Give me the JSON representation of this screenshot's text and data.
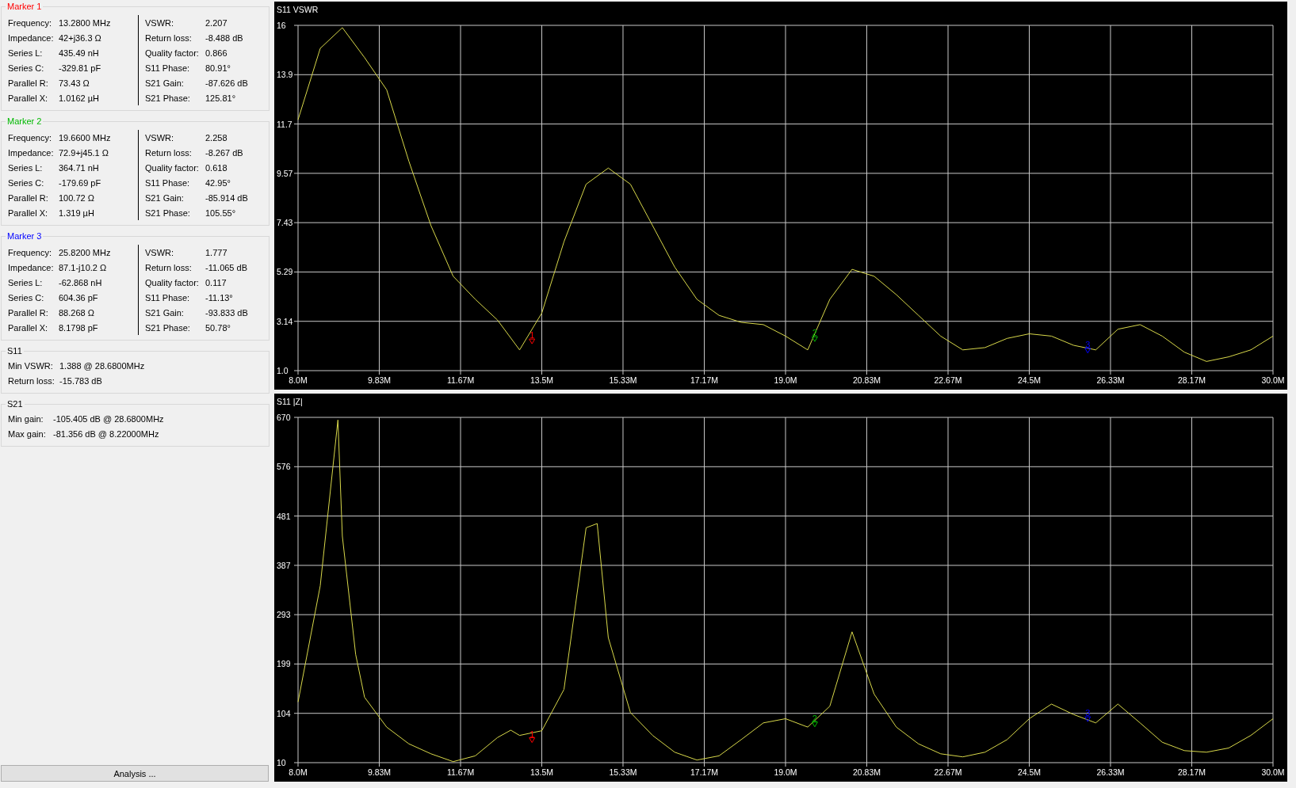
{
  "markers": [
    {
      "title": "Marker 1",
      "color": "#ff0000",
      "left": [
        {
          "label": "Frequency:",
          "value": "13.2800 MHz"
        },
        {
          "label": "Impedance:",
          "value": "42+j36.3 Ω"
        },
        {
          "label": "Series L:",
          "value": "435.49 nH"
        },
        {
          "label": "Series C:",
          "value": "-329.81 pF"
        },
        {
          "label": "Parallel R:",
          "value": "73.43 Ω"
        },
        {
          "label": "Parallel X:",
          "value": "1.0162 µH"
        }
      ],
      "right": [
        {
          "label": "VSWR:",
          "value": "2.207"
        },
        {
          "label": "Return loss:",
          "value": "-8.488 dB"
        },
        {
          "label": "Quality factor:",
          "value": "0.866"
        },
        {
          "label": "S11 Phase:",
          "value": "80.91°"
        },
        {
          "label": "S21 Gain:",
          "value": "-87.626 dB"
        },
        {
          "label": "S21 Phase:",
          "value": "125.81°"
        }
      ]
    },
    {
      "title": "Marker 2",
      "color": "#00b800",
      "left": [
        {
          "label": "Frequency:",
          "value": "19.6600 MHz"
        },
        {
          "label": "Impedance:",
          "value": "72.9+j45.1 Ω"
        },
        {
          "label": "Series L:",
          "value": "364.71 nH"
        },
        {
          "label": "Series C:",
          "value": "-179.69 pF"
        },
        {
          "label": "Parallel R:",
          "value": "100.72 Ω"
        },
        {
          "label": "Parallel X:",
          "value": "1.319 µH"
        }
      ],
      "right": [
        {
          "label": "VSWR:",
          "value": "2.258"
        },
        {
          "label": "Return loss:",
          "value": "-8.267 dB"
        },
        {
          "label": "Quality factor:",
          "value": "0.618"
        },
        {
          "label": "S11 Phase:",
          "value": "42.95°"
        },
        {
          "label": "S21 Gain:",
          "value": "-85.914 dB"
        },
        {
          "label": "S21 Phase:",
          "value": "105.55°"
        }
      ]
    },
    {
      "title": "Marker 3",
      "color": "#0000ff",
      "left": [
        {
          "label": "Frequency:",
          "value": "25.8200 MHz"
        },
        {
          "label": "Impedance:",
          "value": "87.1-j10.2 Ω"
        },
        {
          "label": "Series L:",
          "value": "-62.868 nH"
        },
        {
          "label": "Series C:",
          "value": "604.36 pF"
        },
        {
          "label": "Parallel R:",
          "value": "88.268 Ω"
        },
        {
          "label": "Parallel X:",
          "value": "8.1798 pF"
        }
      ],
      "right": [
        {
          "label": "VSWR:",
          "value": "1.777"
        },
        {
          "label": "Return loss:",
          "value": "-11.065 dB"
        },
        {
          "label": "Quality factor:",
          "value": "0.117"
        },
        {
          "label": "S11 Phase:",
          "value": "-11.13°"
        },
        {
          "label": "S21 Gain:",
          "value": "-93.833 dB"
        },
        {
          "label": "S21 Phase:",
          "value": "50.78°"
        }
      ]
    }
  ],
  "summaries": [
    {
      "title": "S11",
      "rows": [
        {
          "label": "Min VSWR:",
          "value": "1.388 @ 28.6800MHz"
        },
        {
          "label": "Return loss:",
          "value": "-15.783 dB"
        }
      ]
    },
    {
      "title": "S21",
      "rows": [
        {
          "label": "Min gain:",
          "value": "-105.405 dB @ 28.6800MHz"
        },
        {
          "label": "Max gain:",
          "value": "-81.356 dB @ 8.22000MHz"
        }
      ]
    }
  ],
  "analysis_button": "Analysis ...",
  "charts": [
    {
      "chart_data": {
        "type": "line",
        "title": "S11 VSWR",
        "grid": true,
        "x": [
          8,
          8.5,
          9,
          9.5,
          10,
          10.5,
          11,
          11.5,
          12,
          12.5,
          13,
          13.5,
          14,
          14.5,
          15,
          15.5,
          16,
          16.5,
          17,
          17.5,
          18,
          18.5,
          19,
          19.5,
          20,
          20.5,
          21,
          21.5,
          22,
          22.5,
          23,
          23.5,
          24,
          24.5,
          25,
          25.5,
          26,
          26.5,
          27,
          27.5,
          28,
          28.5,
          29,
          29.5,
          30
        ],
        "series": [
          {
            "color": "#d8d84a",
            "values": [
              11.9,
              15.0,
              15.9,
              14.6,
              13.2,
              10.1,
              7.3,
              5.1,
              4.1,
              3.2,
              1.9,
              3.5,
              6.6,
              9.1,
              9.8,
              9.1,
              7.3,
              5.5,
              4.1,
              3.4,
              3.1,
              3.0,
              2.5,
              1.9,
              4.1,
              5.4,
              5.1,
              4.3,
              3.4,
              2.5,
              1.9,
              2.0,
              2.4,
              2.6,
              2.5,
              2.1,
              1.9,
              2.8,
              3.0,
              2.5,
              1.8,
              1.4,
              1.6,
              1.9,
              2.5
            ]
          }
        ],
        "xlim": [
          8,
          30
        ],
        "ylim": [
          1,
          16
        ],
        "xticks": [
          {
            "value": 8,
            "label": "8.0M"
          },
          {
            "value": 9.833,
            "label": "9.83M"
          },
          {
            "value": 11.667,
            "label": "11.67M"
          },
          {
            "value": 13.5,
            "label": "13.5M"
          },
          {
            "value": 15.333,
            "label": "15.33M"
          },
          {
            "value": 17.167,
            "label": "17.17M"
          },
          {
            "value": 19,
            "label": "19.0M"
          },
          {
            "value": 20.833,
            "label": "20.83M"
          },
          {
            "value": 22.667,
            "label": "22.67M"
          },
          {
            "value": 24.5,
            "label": "24.5M"
          },
          {
            "value": 26.333,
            "label": "26.33M"
          },
          {
            "value": 28.167,
            "label": "28.17M"
          },
          {
            "value": 30,
            "label": "30.0M"
          }
        ],
        "yticks": [
          {
            "value": 1,
            "label": "1.0"
          },
          {
            "value": 3.143,
            "label": "3.14"
          },
          {
            "value": 5.286,
            "label": "5.29"
          },
          {
            "value": 7.429,
            "label": "7.43"
          },
          {
            "value": 9.571,
            "label": "9.57"
          },
          {
            "value": 11.714,
            "label": "11.7"
          },
          {
            "value": 13.857,
            "label": "13.9"
          },
          {
            "value": 16,
            "label": "16"
          }
        ],
        "annotations": [
          {
            "x": 13.28,
            "y": 2.2,
            "text": "1"
          },
          {
            "x": 19.66,
            "y": 2.3,
            "text": "2"
          },
          {
            "x": 25.82,
            "y": 1.8,
            "text": "3"
          }
        ]
      }
    },
    {
      "chart_data": {
        "type": "line",
        "title": "S11 |Z|",
        "grid": true,
        "x": [
          8,
          8.5,
          8.9,
          9,
          9.3,
          9.5,
          10,
          10.5,
          11,
          11.5,
          12,
          12.5,
          12.8,
          13,
          13.5,
          14,
          14.5,
          14.75,
          15,
          15.5,
          16,
          16.5,
          17,
          17.5,
          18,
          18.5,
          19,
          19.5,
          20,
          20.5,
          21,
          21.5,
          22,
          22.5,
          23,
          23.5,
          24,
          24.5,
          25,
          25.5,
          26,
          26.5,
          27,
          27.5,
          28,
          28.5,
          29,
          29.5,
          30
        ],
        "series": [
          {
            "color": "#d8d84a",
            "values": [
              126,
              348,
              665,
              443,
              217,
              135,
              78,
              46,
              27,
              12,
              23,
              58,
              72,
              62,
              71,
              150,
              459,
              467,
              249,
              106,
              62,
              30,
              15,
              23,
              54,
              86,
              94,
              78,
              118,
              260,
              141,
              78,
              46,
              27,
              21,
              30,
              54,
              94,
              122,
              102,
              86,
              122,
              86,
              49,
              33,
              30,
              38,
              62,
              94
            ]
          }
        ],
        "xlim": [
          8,
          30
        ],
        "ylim": [
          10,
          670
        ],
        "xticks": [
          {
            "value": 8,
            "label": "8.0M"
          },
          {
            "value": 9.833,
            "label": "9.83M"
          },
          {
            "value": 11.667,
            "label": "11.67M"
          },
          {
            "value": 13.5,
            "label": "13.5M"
          },
          {
            "value": 15.333,
            "label": "15.33M"
          },
          {
            "value": 17.167,
            "label": "17.17M"
          },
          {
            "value": 19,
            "label": "19.0M"
          },
          {
            "value": 20.833,
            "label": "20.83M"
          },
          {
            "value": 22.667,
            "label": "22.67M"
          },
          {
            "value": 24.5,
            "label": "24.5M"
          },
          {
            "value": 26.333,
            "label": "26.33M"
          },
          {
            "value": 28.167,
            "label": "28.17M"
          },
          {
            "value": 30,
            "label": "30.0M"
          }
        ],
        "yticks": [
          {
            "value": 10,
            "label": "10"
          },
          {
            "value": 104.3,
            "label": "104"
          },
          {
            "value": 198.6,
            "label": "199"
          },
          {
            "value": 292.9,
            "label": "293"
          },
          {
            "value": 387.1,
            "label": "387"
          },
          {
            "value": 481.4,
            "label": "481"
          },
          {
            "value": 575.7,
            "label": "576"
          },
          {
            "value": 670,
            "label": "670"
          }
        ],
        "annotations": [
          {
            "x": 13.28,
            "y": 50,
            "text": "1"
          },
          {
            "x": 19.66,
            "y": 80,
            "text": "2"
          },
          {
            "x": 25.82,
            "y": 90,
            "text": "3"
          }
        ]
      }
    }
  ]
}
